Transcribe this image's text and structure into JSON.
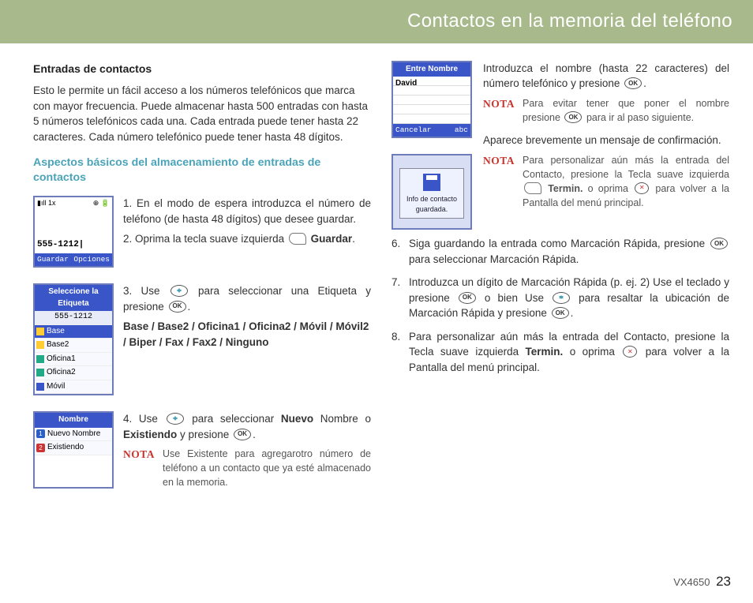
{
  "header": {
    "title": "Contactos en la memoria del teléfono"
  },
  "col_left": {
    "section_heading": "Entradas de contactos",
    "intro": "Esto le permite un fácil acceso a los números telefónicos que marca con mayor frecuencia. Puede almacenar hasta 500 entradas con hasta 5 números telefónicos cada una. Cada entrada puede tener hasta 22 caracteres. Cada número telefónico puede tener hasta 48 dígitos.",
    "subheading": "Aspectos básicos del almacenamiento de entradas de contactos",
    "screen_dial": {
      "topbar_left": "▮ıll  1x",
      "topbar_right": "⊕  🔋",
      "value": "555-1212|",
      "soft_left": "Guardar",
      "soft_right": "Opciones"
    },
    "step1": "1. En el modo de espera introduzca el número de teléfono (de hasta 48 dígitos) que desee guardar.",
    "step2_pre": "2. Oprima la tecla suave izquierda ",
    "step2_post": "Guardar",
    "step2_end": ".",
    "screen_labels": {
      "title": "Seleccione la Etiqueta",
      "number": "555-1212",
      "items": [
        "Base",
        "Base2",
        "Oficina1",
        "Oficina2",
        "Móvil"
      ]
    },
    "step3_pre": "3. Use ",
    "step3_mid": " para seleccionar una Etiqueta y presione ",
    "step3_end": ".",
    "labels_line": "Base / Base2 / Oficina1 / Oficina2 / Móvil / Móvil2 / Biper / Fax / Fax2 / Ninguno",
    "screen_nombre": {
      "title": "Nombre",
      "row1": "Nuevo Nombre",
      "row2": "Existiendo"
    },
    "step4_pre": "4. Use ",
    "step4_mid": " para seleccionar ",
    "step4_b1": "Nuevo",
    "step4_mid2": " Nombre o ",
    "step4_b2": "Existiendo",
    "step4_mid3": " y presione ",
    "step4_end": ".",
    "nota1_label": "NOTA",
    "nota1_text": "Use Existente para agregarotro número de teléfono a un contacto que ya esté almacenado en la memoria."
  },
  "col_right": {
    "screen_name": {
      "title": "Entre Nombre",
      "value": "David",
      "soft_left": "Cancelar",
      "soft_right": "abc"
    },
    "intro_pre": "Introduzca el nombre (hasta 22 caracteres) del número telefónico y presione ",
    "intro_end": ".",
    "nota2_label": "NOTA",
    "nota2_text_pre": "Para evitar tener que poner el nombre presione ",
    "nota2_text_post": " para ir al paso siguiente.",
    "screen_saved": {
      "popup": "Info de contacto guardada."
    },
    "confirm": "Aparece brevemente un mensaje de confirmación.",
    "nota3_label": "NOTA",
    "nota3_text_pre": "Para personalizar aún más la entrada del Contacto, presione la Tecla suave izquierda ",
    "nota3_b1": "Termin.",
    "nota3_mid": " o oprima ",
    "nota3_end": " para volver a la Pantalla del menú principal.",
    "step6_pre": "Siga guardando la entrada como Marcación Rápida, presione ",
    "step6_post": " para seleccionar Marcación Rápida.",
    "step7_pre": "Introduzca un dígito de Marcación Rápida (p. ej. 2) Use el teclado y presione ",
    "step7_mid": " o bien Use ",
    "step7_mid2": " para resaltar la ubicación de Marcación Rápida y presione ",
    "step7_end": ".",
    "step8_pre": "Para personalizar aún más la entrada del Contacto, presione la Tecla suave izquierda ",
    "step8_b": "Termin.",
    "step8_mid": " o oprima ",
    "step8_end": " para volver a la Pantalla del menú principal.",
    "num6": "6.",
    "num7": "7.",
    "num8": "8."
  },
  "footer": {
    "model": "VX4650",
    "page": "23"
  }
}
